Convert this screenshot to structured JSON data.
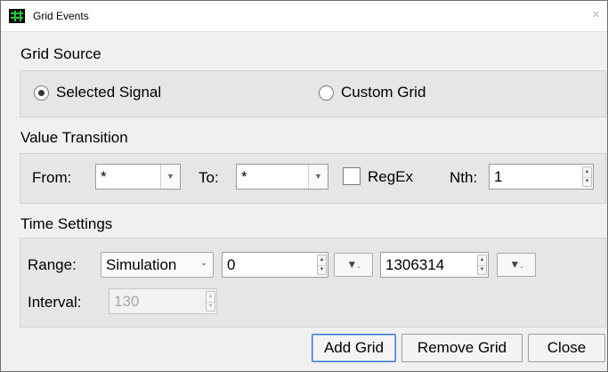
{
  "window": {
    "title": "Grid Events",
    "close_glyph": "×",
    "icon": "grid-app-icon"
  },
  "grid_source": {
    "label": "Grid Source",
    "options": [
      {
        "label": "Selected Signal",
        "checked": true
      },
      {
        "label": "Custom Grid",
        "checked": false
      }
    ]
  },
  "value_transition": {
    "label": "Value Transition",
    "from_label": "From:",
    "from_value": "*",
    "to_label": "To:",
    "to_value": "*",
    "regex_label": "RegEx",
    "regex_checked": false,
    "nth_label": "Nth:",
    "nth_value": "1"
  },
  "time_settings": {
    "label": "Time Settings",
    "range_label": "Range:",
    "range_mode": "Simulation",
    "range_start": "0",
    "range_end": "1306314",
    "interval_label": "Interval:",
    "interval_value": "130",
    "interval_enabled": false
  },
  "buttons": {
    "add_grid": "Add Grid",
    "remove_grid": "Remove Grid",
    "close": "Close"
  },
  "glyphs": {
    "combo_arrow": "▼",
    "spin_up": "▲",
    "spin_down": "▼",
    "unit_drop": "▼.",
    "sim_arrow": "⌄"
  }
}
